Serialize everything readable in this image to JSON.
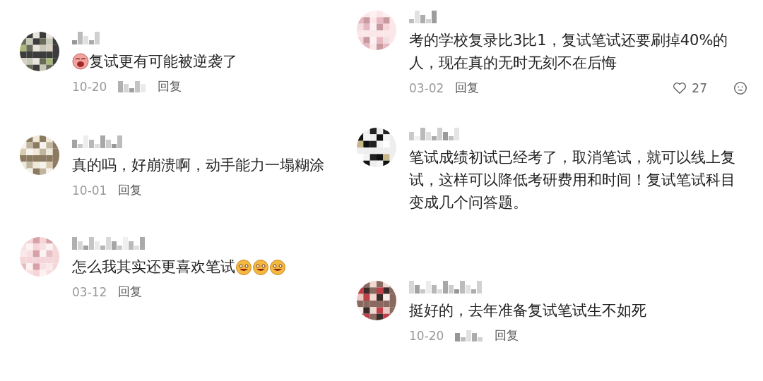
{
  "columns": [
    {
      "comments": [
        {
          "emojis_before": [
            {
              "kind": "cry"
            }
          ],
          "text": "复试更有可能被逆袭了",
          "date": "10-20",
          "location_blurred": true,
          "reply": "回复"
        },
        {
          "text": "真的吗，好崩溃啊，动手能力一塌糊涂",
          "date": "10-01",
          "location_blurred": false,
          "reply": "回复"
        },
        {
          "text": "怎么我其实还更喜欢笔试",
          "emojis_after": [
            {
              "kind": "grin"
            },
            {
              "kind": "grin"
            },
            {
              "kind": "grin"
            }
          ],
          "date": "03-12",
          "location_blurred": false,
          "reply": "回复"
        }
      ]
    },
    {
      "comments": [
        {
          "text": "考的学校复录比3比1，复试笔试还要刷掉40%的人，现在真的无时无刻不在后悔",
          "date": "03-02",
          "location_blurred": false,
          "reply": "回复",
          "likes": "27"
        },
        {
          "text": "笔试成绩初试已经考了，取消笔试，就可以线上复试，这样可以降低考研费用和时间！复试笔试科目变成几个问答题。"
        },
        {
          "text": "挺好的，去年准备复试笔试生不如死",
          "date": "10-20",
          "location_blurred": true,
          "reply": "回复"
        }
      ]
    }
  ]
}
